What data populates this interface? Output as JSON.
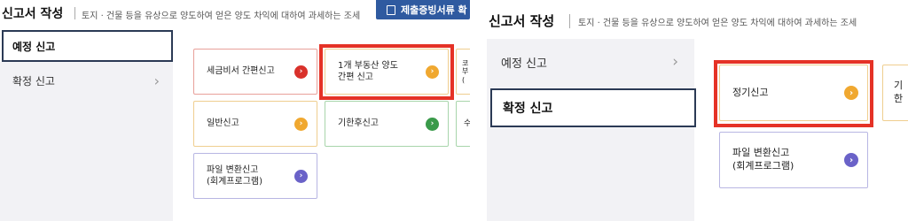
{
  "left": {
    "title": "신고서 작성",
    "description": "토지 · 건물 등을 유상으로 양도하여 얻은 양도 차익에 대하여 과세하는 조세",
    "top_button_label": "제출증빙서류 확",
    "side_items": [
      {
        "label": "예정 신고",
        "active": true
      },
      {
        "label": "확정 신고",
        "active": false,
        "chevron": "›"
      }
    ],
    "cards": [
      {
        "label": "세금비서 간편신고",
        "color": "red"
      },
      {
        "label": "1개 부동산 양도\n간편 신고",
        "color": "orange"
      },
      {
        "label": "일반신고",
        "color": "orange"
      },
      {
        "label": "기한후신고",
        "color": "green"
      },
      {
        "label": "파일 변환신고\n(회계프로그램)",
        "color": "purple"
      }
    ],
    "partial_cards": [
      {
        "label": "코\n부\n(",
        "color": "orange"
      },
      {
        "label": "수",
        "color": "green"
      }
    ]
  },
  "right": {
    "title": "신고서 작성",
    "description": "토지 · 건물 등을 유상으로 양도하여 얻은 양도 차익에 대하여 과세하는 조세",
    "side_items": [
      {
        "label": "예정 신고",
        "active": false,
        "chevron": "›"
      },
      {
        "label": "확정 신고",
        "active": true
      }
    ],
    "cards": [
      {
        "label": "정기신고",
        "color": "orange"
      },
      {
        "label": "파일 변환신고\n(회계프로그램)",
        "color": "purple"
      }
    ],
    "partial_card_label": "기한"
  },
  "icons": {
    "card_arrow": "chevron-right-circle-icon",
    "side_arrow": "chevron-right-icon",
    "doc": "document-icon"
  },
  "colors": {
    "highlight": "#e53226",
    "active_border": "#2b3a55",
    "button_blue": "#2f5aa0",
    "sidebar_bg": "#f2f2f5"
  }
}
